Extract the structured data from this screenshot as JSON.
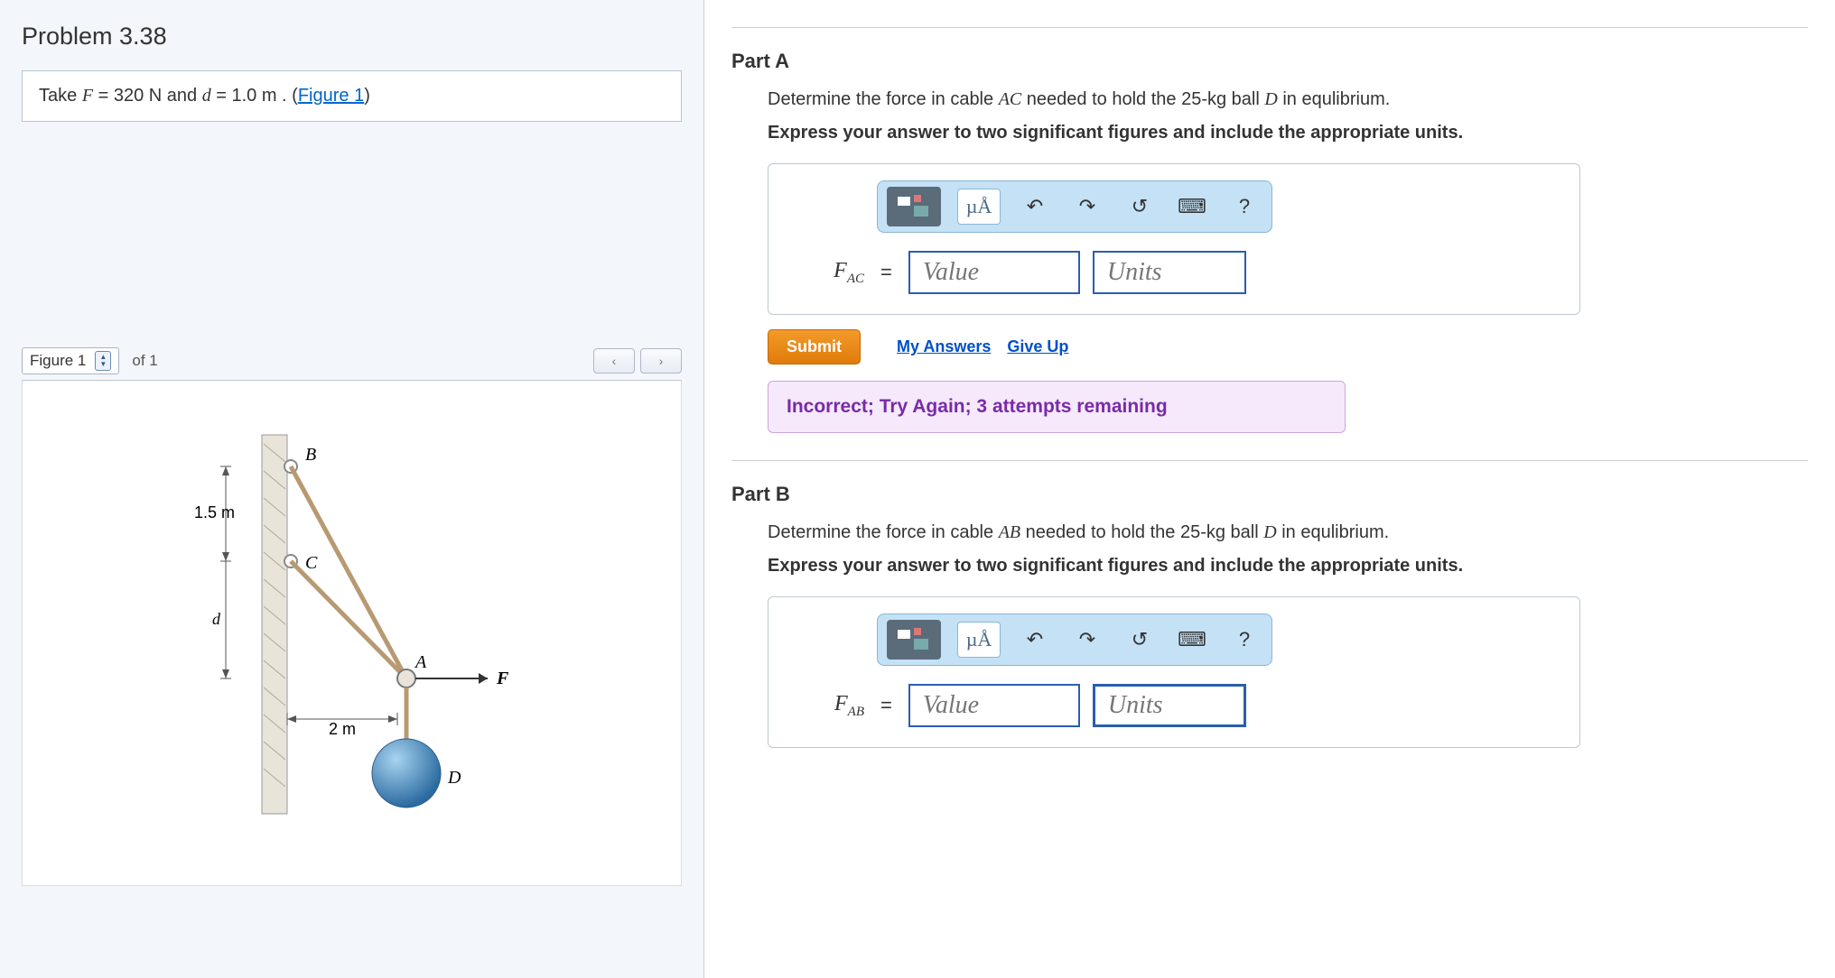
{
  "problem": {
    "title": "Problem 3.38",
    "statement_prefix": "Take ",
    "F_var": "F",
    "F_val": " = 320 N",
    "and": " and ",
    "d_var": "d",
    "d_val": " = 1.0 m",
    "period": " . (",
    "figure_link": "Figure 1",
    "close": ")"
  },
  "figure": {
    "selector_label": "Figure 1",
    "of_label": "of 1",
    "prev": "‹",
    "next": "›",
    "labels": {
      "B": "B",
      "C": "C",
      "A": "A",
      "F": "F",
      "D": "D",
      "d": "d",
      "h": "1.5 m",
      "w": "2 m"
    }
  },
  "toolbar": {
    "units_btn": "µÅ",
    "undo": "↶",
    "redo": "↷",
    "reset": "↺",
    "keyboard": "⌨",
    "help": "?"
  },
  "partA": {
    "title": "Part A",
    "prompt_pre": "Determine the force in cable ",
    "prompt_ac": "AC",
    "prompt_mid": " needed to hold the 25-kg ball ",
    "prompt_d": "D",
    "prompt_post": " in equlibrium.",
    "instruction": "Express your answer to two significant figures and include the appropriate units.",
    "var_main": "F",
    "var_sub": "AC",
    "eq": "=",
    "value_ph": "Value",
    "units_ph": "Units",
    "submit": "Submit",
    "my_answers": "My Answers",
    "give_up": "Give Up",
    "feedback": "Incorrect; Try Again; 3 attempts remaining"
  },
  "partB": {
    "title": "Part B",
    "prompt_pre": "Determine the force in cable ",
    "prompt_ab": "AB",
    "prompt_mid": " needed to hold the 25-kg ball ",
    "prompt_d": "D",
    "prompt_post": " in equlibrium.",
    "instruction": "Express your answer to two significant figures and include the appropriate units.",
    "var_main": "F",
    "var_sub": "AB",
    "eq": "=",
    "value_ph": "Value",
    "units_ph": "Units"
  }
}
